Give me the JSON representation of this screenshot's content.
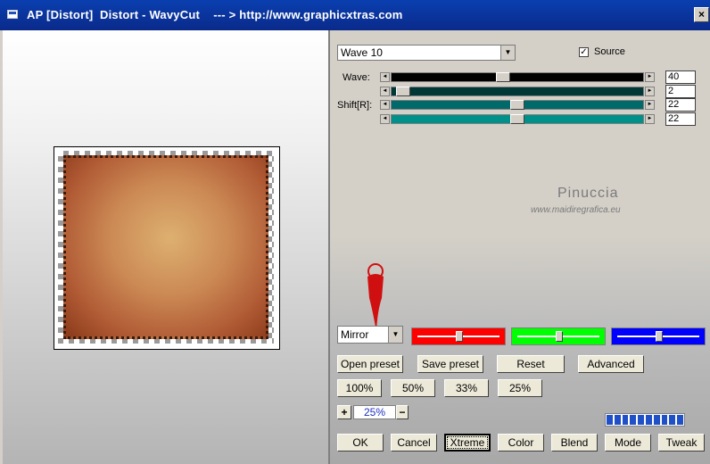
{
  "window": {
    "title": "AP [Distort]  Distort - WavyCut    --- > http://www.graphicxtras.com",
    "close_glyph": "×"
  },
  "preset_combo": {
    "value": "Wave 10",
    "arrow": "▼"
  },
  "source_checkbox": {
    "label": "Source",
    "checked": true,
    "mark": "✓"
  },
  "sliders": {
    "wave_label": "Wave:",
    "shift_label": "Shift[R]:",
    "rows": [
      {
        "value": "40",
        "level": 0.44,
        "color": "#000000"
      },
      {
        "value": "2",
        "level": 0.02,
        "color": "#003838"
      },
      {
        "value": "22",
        "level": 0.5,
        "color": "#006a6a"
      },
      {
        "value": "22",
        "level": 0.5,
        "color": "#00908a"
      }
    ],
    "arrow_left": "◄",
    "arrow_right": "►"
  },
  "watermark": {
    "name": "Pinuccia",
    "url": "www.maidiregrafica.eu"
  },
  "mirror_combo": {
    "value": "Mirror",
    "arrow": "▼"
  },
  "color_sliders": [
    {
      "color": "#ff0000",
      "level": 0.5
    },
    {
      "color": "#00ff00",
      "level": 0.5
    },
    {
      "color": "#0000ff",
      "level": 0.5
    }
  ],
  "buttons": {
    "open_preset": "Open preset",
    "save_preset": "Save preset",
    "reset": "Reset",
    "advanced": "Advanced",
    "zoom100": "100%",
    "zoom50": "50%",
    "zoom33": "33%",
    "zoom25": "25%",
    "zoom_in": "+",
    "zoom_out": "−",
    "ok": "OK",
    "cancel": "Cancel",
    "xtreme": "Xtreme",
    "color": "Color",
    "blend": "Blend",
    "mode": "Mode",
    "tweak": "Tweak"
  },
  "zoom_value": "25%",
  "progress_segments": 10,
  "colors": {
    "titlebar": "#0a3fb0",
    "dialog": "#d4d0c8",
    "accent_blue": "#2050c8"
  }
}
